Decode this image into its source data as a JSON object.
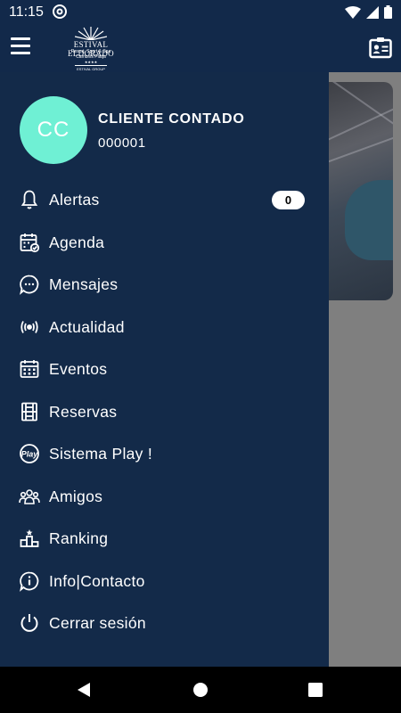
{
  "status": {
    "time": "11:15"
  },
  "header": {
    "logo": {
      "line1": "ESTIVAL ELDORADO",
      "line2": "Resort, Sport & Spa",
      "line3": "Cambrils Platja",
      "line4": "★★★★",
      "line5": "ESTIVAL GROUP"
    }
  },
  "user": {
    "initials": "CC",
    "name": "CLIENTE CONTADO",
    "id": "000001"
  },
  "menu": [
    {
      "label": "Alertas",
      "icon": "bell-icon",
      "badge": "0"
    },
    {
      "label": "Agenda",
      "icon": "calendar-check-icon"
    },
    {
      "label": "Mensajes",
      "icon": "chat-bubble-icon"
    },
    {
      "label": "Actualidad",
      "icon": "broadcast-icon"
    },
    {
      "label": "Eventos",
      "icon": "calendar-grid-icon"
    },
    {
      "label": "Reservas",
      "icon": "court-icon"
    },
    {
      "label": "Sistema Play !",
      "icon": "play-badge-icon"
    },
    {
      "label": "Amigos",
      "icon": "people-icon"
    },
    {
      "label": "Ranking",
      "icon": "podium-icon"
    },
    {
      "label": "Info|Contacto",
      "icon": "info-icon"
    },
    {
      "label": "Cerrar sesión",
      "icon": "power-icon"
    }
  ],
  "colors": {
    "accent": "#6ff0d4",
    "drawer": "#132a49",
    "header": "#12294a"
  }
}
